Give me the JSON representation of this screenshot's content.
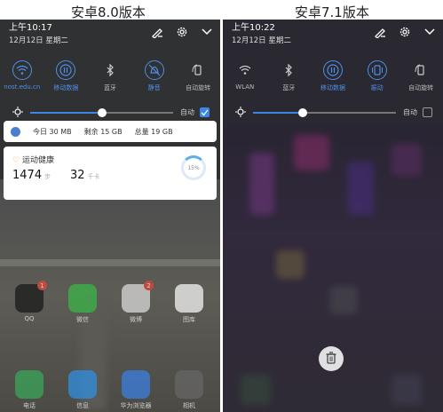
{
  "captions": {
    "left": "安卓8.0版本",
    "right": "安卓7.1版本"
  },
  "android8": {
    "time": "上午10:17",
    "date": "12月12日 星期二",
    "toggles": [
      {
        "label": "nost.edu.cn",
        "icon": "wifi-icon",
        "active": true
      },
      {
        "label": "移动数据",
        "icon": "mobile-data-icon",
        "active": true
      },
      {
        "label": "蓝牙",
        "icon": "bluetooth-icon",
        "active": false
      },
      {
        "label": "静音",
        "icon": "mute-icon",
        "active": true
      },
      {
        "label": "自动旋转",
        "icon": "rotate-icon",
        "active": false
      }
    ],
    "brightness": {
      "level": 0.5,
      "auto_label": "自动",
      "auto_checked": true
    },
    "data_usage": {
      "today": "今日 30 MB",
      "remaining": "剩余 15 GB",
      "total": "总量 19 GB"
    },
    "health": {
      "title": "运动健康",
      "steps": "1474",
      "steps_unit": "步",
      "floors": "32",
      "floors_unit": "千卡",
      "progress": "15%"
    },
    "apps_row1": [
      {
        "label": "QQ",
        "badge": "1",
        "color": "#1a1a1a"
      },
      {
        "label": "微信",
        "badge": "",
        "color": "#3bb54a"
      },
      {
        "label": "微博",
        "badge": "2",
        "color": "#d9d9d9"
      },
      {
        "label": "图库",
        "badge": "",
        "color": "#f4f4f4"
      }
    ],
    "apps_row2": [
      {
        "label": "电话",
        "color": "#3aa55a"
      },
      {
        "label": "信息",
        "color": "#2f8fe0"
      },
      {
        "label": "华为浏览器",
        "color": "#3b7fe0"
      },
      {
        "label": "相机",
        "color": "#666666"
      }
    ]
  },
  "android7": {
    "time": "上午10:22",
    "date": "12月12日 星期二",
    "toggles": [
      {
        "label": "WLAN",
        "icon": "wifi-icon",
        "active": false
      },
      {
        "label": "蓝牙",
        "icon": "bluetooth-icon",
        "active": false
      },
      {
        "label": "移动数据",
        "icon": "mobile-data-icon",
        "active": true
      },
      {
        "label": "振动",
        "icon": "vibrate-icon",
        "active": true
      },
      {
        "label": "自动旋转",
        "icon": "rotate-icon",
        "active": false
      }
    ],
    "brightness": {
      "level": 0.35,
      "auto_label": "自动",
      "auto_checked": false
    }
  },
  "colors": {
    "accent": "#3d86e6",
    "panel_dark": "#2d2f31"
  }
}
